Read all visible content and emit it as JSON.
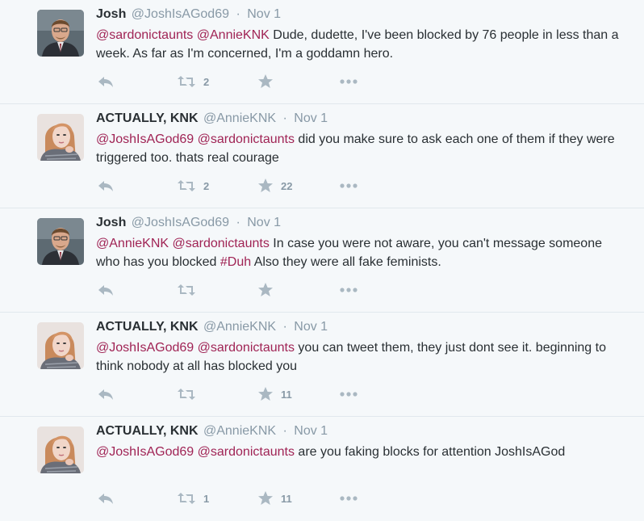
{
  "colors": {
    "mention": "#a02455",
    "muted": "#8899a6",
    "text": "#292f33",
    "bg": "#f5f8fa"
  },
  "icons": {
    "reply": "reply-icon",
    "retweet": "retweet-icon",
    "favorite": "star-icon",
    "more": "more-dots-icon"
  },
  "tweets": [
    {
      "name": "Josh",
      "handle": "@JoshIsAGod69",
      "sep": "·",
      "time": "Nov 1",
      "avatar": "male",
      "m1": "@sardonictaunts",
      "m2": "@AnnieKNK",
      "rest": " Dude, dudette, I've been blocked by 76 people in less than a week. As far as I'm concerned, I'm a goddamn hero.",
      "retweets": "2",
      "favorites": ""
    },
    {
      "name": "ACTUALLY, KNK",
      "handle": "@AnnieKNK",
      "sep": "·",
      "time": "Nov 1",
      "avatar": "female",
      "m1": "@JoshIsAGod69",
      "m2": "@sardonictaunts",
      "rest": " did you make sure to ask each one of them if they were triggered too. thats real courage",
      "retweets": "2",
      "favorites": "22"
    },
    {
      "name": "Josh",
      "handle": "@JoshIsAGod69",
      "sep": "·",
      "time": "Nov 1",
      "avatar": "male",
      "m1": "@AnnieKNK",
      "m2": "@sardonictaunts",
      "rest": " In case you were not aware, you can't message someone who has you blocked ",
      "hashtag": "#Duh",
      "rest2": " Also they were all fake feminists.",
      "retweets": "",
      "favorites": ""
    },
    {
      "name": "ACTUALLY, KNK",
      "handle": "@AnnieKNK",
      "sep": "·",
      "time": "Nov 1",
      "avatar": "female",
      "m1": "@JoshIsAGod69",
      "m2": "@sardonictaunts",
      "rest": " you can tweet them, they just dont see it. beginning to think nobody at all has blocked you",
      "retweets": "",
      "favorites": "11"
    },
    {
      "name": "ACTUALLY, KNK",
      "handle": "@AnnieKNK",
      "sep": "·",
      "time": "Nov 1",
      "avatar": "female",
      "m1": "@JoshIsAGod69",
      "m2": "@sardonictaunts",
      "rest": " are you faking blocks for attention JoshIsAGod",
      "retweets": "1",
      "favorites": "11"
    }
  ]
}
